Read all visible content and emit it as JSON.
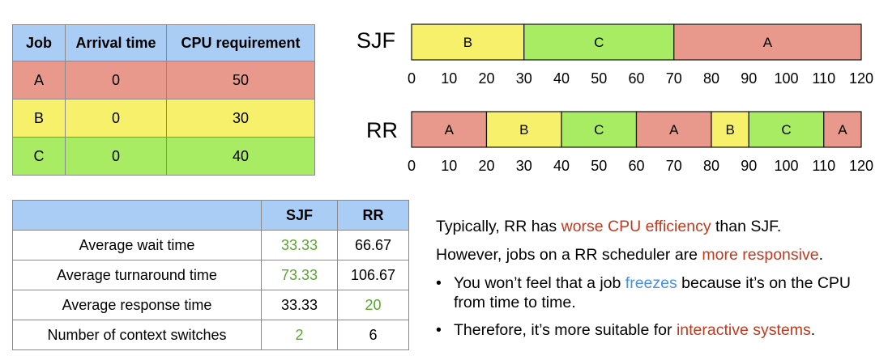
{
  "job_table": {
    "headers": [
      "Job",
      "Arrival time",
      "CPU requirement"
    ],
    "rows": [
      {
        "job": "A",
        "arrival": "0",
        "cpu": "50",
        "color": "#e8998c"
      },
      {
        "job": "B",
        "arrival": "0",
        "cpu": "30",
        "color": "#f7f06a"
      },
      {
        "job": "C",
        "arrival": "0",
        "cpu": "40",
        "color": "#a8ec63"
      }
    ]
  },
  "colors": {
    "A": "#e8998c",
    "B": "#f7f06a",
    "C": "#a8ec63",
    "header": "#a9cdf5"
  },
  "chart_data": [
    {
      "type": "gantt",
      "title": "SJF",
      "x_ticks": [
        "0",
        "10",
        "20",
        "30",
        "40",
        "50",
        "60",
        "70",
        "80",
        "90",
        "100",
        "110",
        "120"
      ],
      "xlim": [
        0,
        120
      ],
      "segments": [
        {
          "label": "B",
          "start": 0,
          "end": 30
        },
        {
          "label": "C",
          "start": 30,
          "end": 70
        },
        {
          "label": "A",
          "start": 70,
          "end": 120
        }
      ]
    },
    {
      "type": "gantt",
      "title": "RR",
      "x_ticks": [
        "0",
        "10",
        "20",
        "30",
        "40",
        "50",
        "60",
        "70",
        "80",
        "90",
        "100",
        "110",
        "120"
      ],
      "xlim": [
        0,
        120
      ],
      "segments": [
        {
          "label": "A",
          "start": 0,
          "end": 20
        },
        {
          "label": "B",
          "start": 20,
          "end": 40
        },
        {
          "label": "C",
          "start": 40,
          "end": 60
        },
        {
          "label": "A",
          "start": 60,
          "end": 80
        },
        {
          "label": "B",
          "start": 80,
          "end": 90
        },
        {
          "label": "C",
          "start": 90,
          "end": 110
        },
        {
          "label": "A",
          "start": 110,
          "end": 120
        }
      ]
    }
  ],
  "metrics_table": {
    "headers": [
      "",
      "SJF",
      "RR"
    ],
    "rows": [
      {
        "metric": "Average wait time",
        "sjf": "33.33",
        "rr": "66.67",
        "best": "sjf"
      },
      {
        "metric": "Average turnaround time",
        "sjf": "73.33",
        "rr": "106.67",
        "best": "sjf"
      },
      {
        "metric": "Average response time",
        "sjf": "33.33",
        "rr": "20",
        "best": "rr"
      },
      {
        "metric": "Number of context switches",
        "sjf": "2",
        "rr": "6",
        "best": "sjf"
      }
    ]
  },
  "notes": {
    "line1": {
      "pre": "Typically, RR has ",
      "hl": "worse CPU efficiency",
      "post": " than SJF."
    },
    "line2": {
      "pre": "However, jobs on a RR scheduler are ",
      "hl": "more responsive",
      "post": "."
    },
    "bullet_char": "•",
    "bullet1": {
      "pre": "You won’t feel that a job ",
      "hl": "freezes",
      "post": " because it’s on the CPU from time to time."
    },
    "bullet2": {
      "pre": "Therefore, it’s more suitable for ",
      "hl": "interactive systems",
      "post": "."
    }
  }
}
